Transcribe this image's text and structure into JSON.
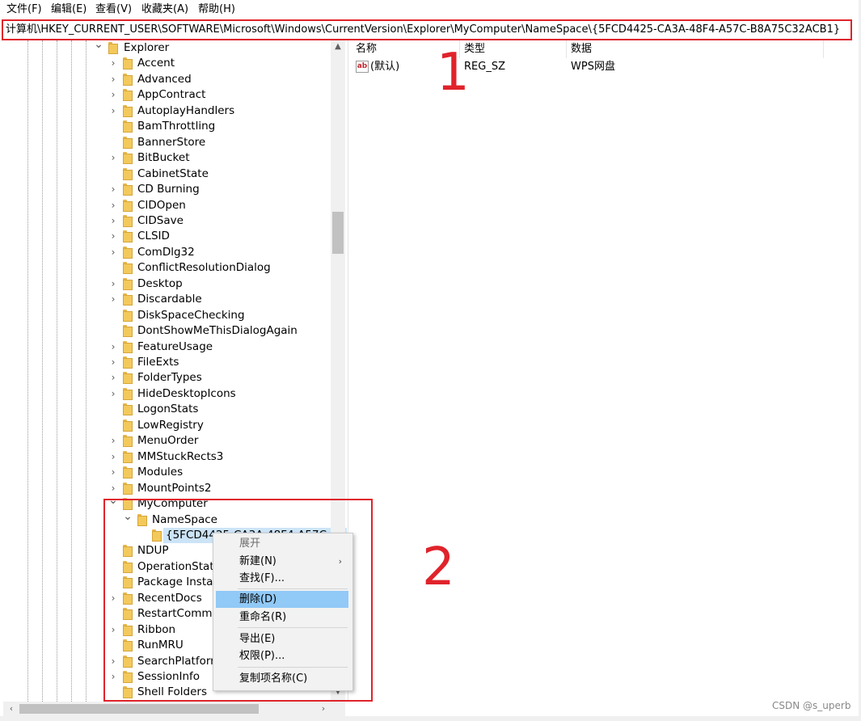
{
  "menu": [
    "文件(F)",
    "编辑(E)",
    "查看(V)",
    "收藏夹(A)",
    "帮助(H)"
  ],
  "address": "计算机\\HKEY_CURRENT_USER\\SOFTWARE\\Microsoft\\Windows\\CurrentVersion\\Explorer\\MyComputer\\NameSpace\\{5FCD4425-CA3A-48F4-A57C-B8A75C32ACB1}",
  "tree": {
    "root": "Explorer",
    "children": [
      "Accent",
      "Advanced",
      "AppContract",
      "AutoplayHandlers",
      "BamThrottling",
      "BannerStore",
      "BitBucket",
      "CabinetState",
      "CD Burning",
      "CIDOpen",
      "CIDSave",
      "CLSID",
      "ComDlg32",
      "ConflictResolutionDialog",
      "Desktop",
      "Discardable",
      "DiskSpaceChecking",
      "DontShowMeThisDialogAgain",
      "FeatureUsage",
      "FileExts",
      "FolderTypes",
      "HideDesktopIcons",
      "LogonStats",
      "LowRegistry",
      "MenuOrder",
      "MMStuckRects3",
      "Modules",
      "MountPoints2",
      "MyComputer"
    ],
    "namespace": "NameSpace",
    "selected": "{5FCD4425-CA3A-48F4-A57C-B8",
    "after": [
      "NDUP",
      "OperationStatu",
      "Package Install",
      "RecentDocs",
      "RestartComma",
      "Ribbon",
      "RunMRU",
      "SearchPlatform",
      "SessionInfo",
      "Shell Folders"
    ]
  },
  "columns": {
    "name": "名称",
    "type": "类型",
    "data": "数据"
  },
  "value_row": {
    "name": "(默认)",
    "type": "REG_SZ",
    "data": "WPS网盘",
    "icon": "ab"
  },
  "context_menu": {
    "expand": "展开",
    "new": "新建(N)",
    "find": "查找(F)...",
    "delete": "删除(D)",
    "rename": "重命名(R)",
    "export": "导出(E)",
    "permissions": "权限(P)...",
    "copy_key_name": "复制项名称(C)"
  },
  "annotations": {
    "one": "1",
    "two": "2"
  },
  "watermark": "CSDN @s_uperb",
  "colors": {
    "annotation": "#e0232b",
    "menu_highlight": "#91c9f7",
    "tree_selection": "#cce4f7",
    "folder": "#f3c95b"
  }
}
